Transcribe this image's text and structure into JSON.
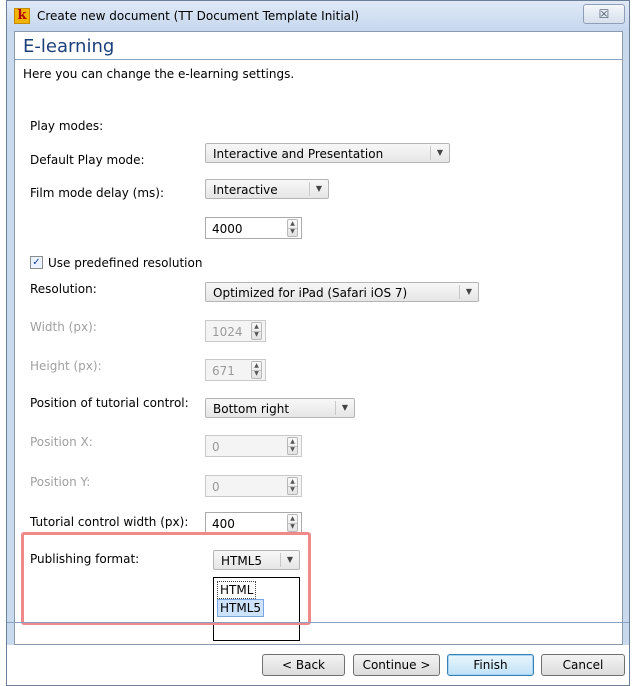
{
  "window": {
    "title": "Create new document (TT Document Template Initial)",
    "close_label": "☒"
  },
  "header": {
    "title": "E-learning",
    "subtitle": "Here you can change the e-learning settings."
  },
  "form": {
    "play_modes": {
      "label": "Play modes:",
      "value": "Interactive and Presentation"
    },
    "default_play_mode": {
      "label": "Default Play mode:",
      "value": "Interactive"
    },
    "film_mode_delay": {
      "label": "Film mode delay (ms):",
      "value": "4000"
    },
    "use_predefined_resolution": {
      "label": "Use predefined resolution",
      "checked": true
    },
    "resolution": {
      "label": "Resolution:",
      "value": "Optimized for iPad (Safari iOS 7)"
    },
    "width": {
      "label": "Width (px):",
      "value": "1024",
      "disabled": true
    },
    "height": {
      "label": "Height (px):",
      "value": "671",
      "disabled": true
    },
    "tutorial_control_position": {
      "label": "Position of tutorial control:",
      "value": "Bottom right"
    },
    "position_x": {
      "label": "Position X:",
      "value": "0",
      "disabled": true
    },
    "position_y": {
      "label": "Position Y:",
      "value": "0",
      "disabled": true
    },
    "tutorial_control_width": {
      "label": "Tutorial control width (px):",
      "value": "400"
    },
    "publishing_format": {
      "label": "Publishing format:",
      "value": "HTML5",
      "options": [
        "HTML",
        "HTML5"
      ],
      "selected": "HTML5"
    }
  },
  "footer": {
    "back": "< Back",
    "continue": "Continue >",
    "finish": "Finish",
    "cancel": "Cancel"
  },
  "colors": {
    "header_title": "#1c3f7a",
    "highlight_box": "#f08a8a",
    "selected_option": "#cde3fb"
  }
}
